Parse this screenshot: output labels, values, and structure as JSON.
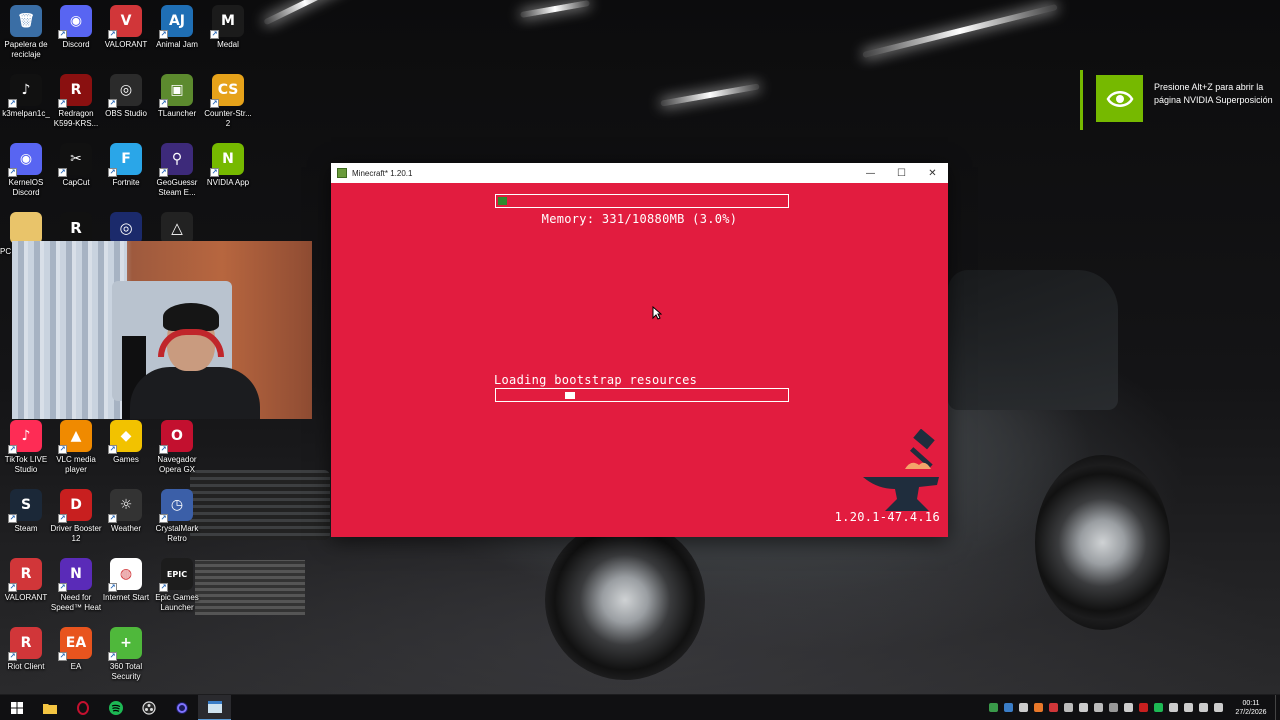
{
  "desktop": {
    "icons": [
      {
        "label": "Papelera de reciclaje",
        "color": "#3a6ea5",
        "glyph": "🗑"
      },
      {
        "label": "Discord",
        "color": "#5865f2",
        "glyph": "◉"
      },
      {
        "label": "VALORANT",
        "color": "#d13639",
        "glyph": "V"
      },
      {
        "label": "Animal Jam",
        "color": "#1f6fb5",
        "glyph": "AJ"
      },
      {
        "label": "Medal",
        "color": "#1b1b1b",
        "glyph": "M"
      },
      {
        "label": "k3melpan1c_",
        "color": "#111111",
        "glyph": "♪"
      },
      {
        "label": "Redragon K599-KRS...",
        "color": "#8a1010",
        "glyph": "R"
      },
      {
        "label": "OBS Studio",
        "color": "#2b2b2b",
        "glyph": "◎"
      },
      {
        "label": "TLauncher",
        "color": "#5c8a2e",
        "glyph": "▣"
      },
      {
        "label": "Counter-Str... 2",
        "color": "#e6a21a",
        "glyph": "CS"
      },
      {
        "label": "KernelOS Discord",
        "color": "#5865f2",
        "glyph": "◉"
      },
      {
        "label": "CapCut",
        "color": "#111111",
        "glyph": "✂"
      },
      {
        "label": "Fortnite",
        "color": "#2aa6e8",
        "glyph": "F"
      },
      {
        "label": "GeoGuessr Steam E...",
        "color": "#3d2a7a",
        "glyph": "⚲"
      },
      {
        "label": "NVIDIA App",
        "color": "#76b900",
        "glyph": "N"
      },
      {
        "label": "TikTok LIVE Studio",
        "color": "#fe2c55",
        "glyph": "♪"
      },
      {
        "label": "VLC media player",
        "color": "#f08a00",
        "glyph": "▲"
      },
      {
        "label": "Games",
        "color": "#f2c200",
        "glyph": "◆"
      },
      {
        "label": "Navegador Opera GX",
        "color": "#c3102f",
        "glyph": "O"
      },
      {
        "label": "Steam",
        "color": "#1b2838",
        "glyph": "S"
      },
      {
        "label": "Driver Booster 12",
        "color": "#c81f1f",
        "glyph": "D"
      },
      {
        "label": "Weather",
        "color": "#333333",
        "glyph": "☼"
      },
      {
        "label": "CrystalMark Retro",
        "color": "#3b5fa8",
        "glyph": "◷"
      },
      {
        "label": "VALORANT",
        "color": "#d13639",
        "glyph": "R"
      },
      {
        "label": "Need for Speed™ Heat",
        "color": "#5a2bb8",
        "glyph": "N"
      },
      {
        "label": "Internet Start",
        "color": "#ffffff",
        "glyph": "◍"
      },
      {
        "label": "Epic Games Launcher",
        "color": "#1c1c1c",
        "glyph": "EPIC"
      },
      {
        "label": "Riot Client",
        "color": "#d13639",
        "glyph": "R"
      },
      {
        "label": "EA",
        "color": "#e8541e",
        "glyph": "EA"
      },
      {
        "label": "360 Total Security",
        "color": "#4fb83b",
        "glyph": "+"
      }
    ],
    "partial_icons": [
      {
        "label": "PC",
        "color": "#e9c46a",
        "glyph": ""
      },
      {
        "label": "",
        "color": "#111111",
        "glyph": "R"
      },
      {
        "label": "",
        "color": "#1b2a6b",
        "glyph": "◎"
      },
      {
        "label": "",
        "color": "#222222",
        "glyph": "△"
      }
    ]
  },
  "nvidia_overlay": {
    "message": "Presione Alt+Z para abrir la página NVIDIA Superposición",
    "accent": "#76b900"
  },
  "minecraft_window": {
    "title": "Minecraft* 1.20.1",
    "minimize": "—",
    "maximize": "☐",
    "close": "✕",
    "background": "#e21c3f",
    "memory_text": "Memory: 331/10880MB (3.0%)",
    "memory_progress": 0.03,
    "memory_fill_color": "#2e8b2e",
    "loading_text": "Loading bootstrap resources",
    "loading_indicator_position": 0.24,
    "version": "1.20.1-47.4.16"
  },
  "taskbar": {
    "items": [
      {
        "name": "start",
        "color": "#ffffff"
      },
      {
        "name": "file-explorer",
        "color": "#f4c542"
      },
      {
        "name": "opera-gx",
        "color": "#c3102f"
      },
      {
        "name": "spotify",
        "color": "#1db954"
      },
      {
        "name": "obs",
        "color": "#dddddd"
      },
      {
        "name": "app-purple",
        "color": "#5b4dd6"
      },
      {
        "name": "minecraft",
        "color": "#cfe3f0"
      }
    ],
    "tray_colors": [
      "#3a9a4a",
      "#3a7dc7",
      "#cccccc",
      "#e8782a",
      "#d13639",
      "#bbbbbb",
      "#cccccc",
      "#bbbbbb",
      "#999999",
      "#cccccc",
      "#c81f1f",
      "#1db954",
      "#cccccc",
      "#cccccc",
      "#cccccc",
      "#cccccc"
    ],
    "time": "00:11",
    "date": "27/2/2026"
  }
}
